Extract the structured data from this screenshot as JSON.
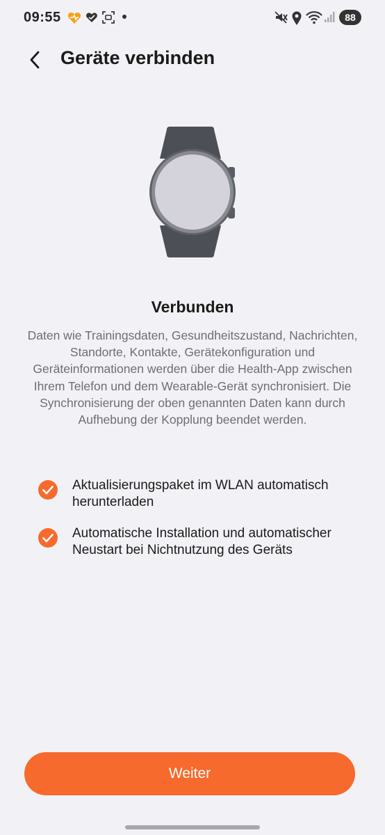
{
  "status_bar": {
    "time": "09:55",
    "battery": "88",
    "icons": [
      "health-heart-icon",
      "heart-icon",
      "screenshot-icon",
      "dot-icon",
      "mute-icon",
      "location-icon",
      "wifi-icon",
      "signal-icon"
    ]
  },
  "header": {
    "title": "Geräte verbinden"
  },
  "device": {
    "image": "smartwatch-icon"
  },
  "status": {
    "title": "Verbunden",
    "description": "Daten wie Trainingsdaten, Gesundheitszustand, Nachrichten, Standorte, Kontakte, Gerätekonfiguration und Geräteinformationen werden über die Health-App zwischen Ihrem Telefon und dem Wearable-Gerät synchronisiert. Die Synchronisierung der oben genannten Daten kann durch Aufhebung der Kopplung beendet werden."
  },
  "options": [
    {
      "label": "Aktualisierungspaket im WLAN automatisch herunterladen",
      "checked": true
    },
    {
      "label": "Automatische Installation und automatischer Neustart bei Nichtnutzung des Geräts",
      "checked": true
    }
  ],
  "footer": {
    "button_label": "Weiter"
  },
  "colors": {
    "accent": "#f76a2d",
    "background": "#f2f2f6"
  }
}
